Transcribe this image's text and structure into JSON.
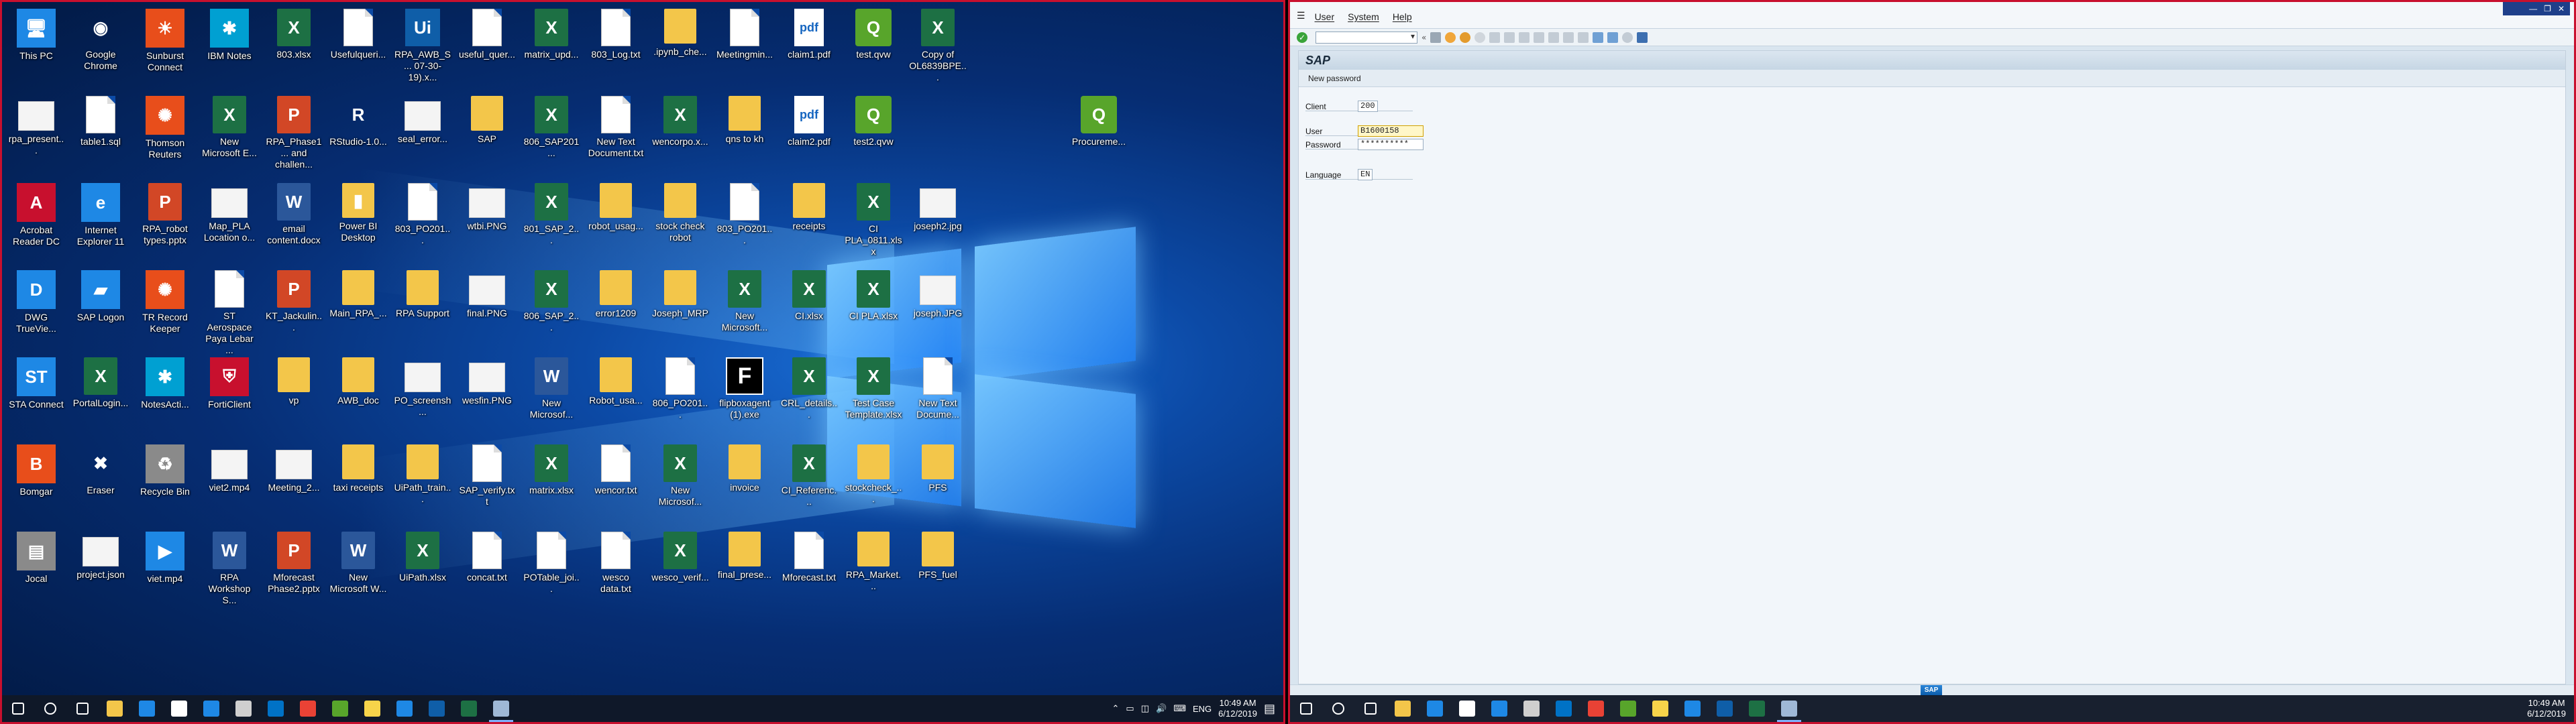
{
  "left_desktop": {
    "icons": [
      {
        "label": "This PC",
        "icon": "this-pc-icon",
        "kind": "blue",
        "glyph": "🖥"
      },
      {
        "label": "Google Chrome",
        "icon": "chrome-icon",
        "kind": "round",
        "glyph": "◉"
      },
      {
        "label": "Sunburst Connect",
        "icon": "sunburst-icon",
        "kind": "orange",
        "glyph": "☀"
      },
      {
        "label": "IBM Notes",
        "icon": "ibm-notes-icon",
        "kind": "teal",
        "glyph": "✱"
      },
      {
        "label": "803.xlsx",
        "icon": "excel-file-icon",
        "kind": "xls",
        "glyph": "X"
      },
      {
        "label": "Usefulqueri...",
        "icon": "document-icon",
        "kind": "doc",
        "glyph": ""
      },
      {
        "label": "RPA_AWB_S... 07-30-19).x...",
        "icon": "uipath-icon",
        "kind": "uipath",
        "glyph": "Ui"
      },
      {
        "label": "useful_quer...",
        "icon": "document-icon",
        "kind": "doc",
        "glyph": ""
      },
      {
        "label": "matrix_upd...",
        "icon": "excel-file-icon",
        "kind": "xls",
        "glyph": "X"
      },
      {
        "label": "803_Log.txt",
        "icon": "text-file-icon",
        "kind": "doc",
        "glyph": ""
      },
      {
        "label": ".ipynb_che...",
        "icon": "folder-icon",
        "kind": "folder",
        "glyph": ""
      },
      {
        "label": "Meetingmin...",
        "icon": "document-icon",
        "kind": "doc",
        "glyph": ""
      },
      {
        "label": "claim1.pdf",
        "icon": "pdf-icon",
        "kind": "pdf",
        "glyph": "pdf"
      },
      {
        "label": "test.qvw",
        "icon": "qlikview-icon",
        "kind": "qv",
        "glyph": "Q"
      },
      {
        "label": "Copy of OL6839BPE...",
        "icon": "excel-file-icon",
        "kind": "xls",
        "glyph": "X"
      },
      {
        "label": "rpa_present...",
        "icon": "image-file-icon",
        "kind": "img",
        "glyph": ""
      },
      {
        "label": "table1.sql",
        "icon": "sql-file-icon",
        "kind": "doc",
        "glyph": ""
      },
      {
        "label": "Thomson Reuters",
        "icon": "thomson-reuters-icon",
        "kind": "orange",
        "glyph": "✺"
      },
      {
        "label": "New Microsoft E...",
        "icon": "excel-file-icon",
        "kind": "xls",
        "glyph": "X"
      },
      {
        "label": "RPA_Phase1... and challen...",
        "icon": "powerpoint-icon",
        "kind": "ppt",
        "glyph": "P"
      },
      {
        "label": "RStudio-1.0...",
        "icon": "rstudio-icon",
        "kind": "round",
        "glyph": "R"
      },
      {
        "label": "seal_error...",
        "icon": "image-file-icon",
        "kind": "img",
        "glyph": ""
      },
      {
        "label": "SAP",
        "icon": "folder-icon",
        "kind": "folder",
        "glyph": ""
      },
      {
        "label": "806_SAP201...",
        "icon": "excel-file-icon",
        "kind": "xls",
        "glyph": "X"
      },
      {
        "label": "New Text Document.txt",
        "icon": "text-file-icon",
        "kind": "doc",
        "glyph": ""
      },
      {
        "label": "wencorpo.x...",
        "icon": "excel-file-icon",
        "kind": "xls",
        "glyph": "X"
      },
      {
        "label": "qns to kh",
        "icon": "folder-icon",
        "kind": "folder",
        "glyph": ""
      },
      {
        "label": "claim2.pdf",
        "icon": "pdf-icon",
        "kind": "pdf",
        "glyph": "pdf"
      },
      {
        "label": "test2.qvw",
        "icon": "qlikview-icon",
        "kind": "qv",
        "glyph": "Q"
      },
      {
        "label": "Procureme...",
        "icon": "qlikview-icon",
        "kind": "qv",
        "glyph": "Q"
      },
      {
        "label": "Acrobat Reader DC",
        "icon": "acrobat-icon",
        "kind": "red",
        "glyph": "A"
      },
      {
        "label": "Internet Explorer 11",
        "icon": "internet-explorer-icon",
        "kind": "blue",
        "glyph": "e"
      },
      {
        "label": "RPA_robot types.pptx",
        "icon": "powerpoint-icon",
        "kind": "ppt",
        "glyph": "P"
      },
      {
        "label": "Map_PLA Location o...",
        "icon": "image-file-icon",
        "kind": "img",
        "glyph": ""
      },
      {
        "label": "email content.docx",
        "icon": "word-icon",
        "kind": "word",
        "glyph": "W"
      },
      {
        "label": "Power BI Desktop",
        "icon": "power-bi-icon",
        "kind": "folder",
        "glyph": "▮"
      },
      {
        "label": "803_PO201...",
        "icon": "document-icon",
        "kind": "doc",
        "glyph": ""
      },
      {
        "label": "wtbi.PNG",
        "icon": "image-file-icon",
        "kind": "img",
        "glyph": ""
      },
      {
        "label": "801_SAP_2...",
        "icon": "excel-file-icon",
        "kind": "xls",
        "glyph": "X"
      },
      {
        "label": "robot_usag...",
        "icon": "folder-icon",
        "kind": "folder",
        "glyph": ""
      },
      {
        "label": "stock check robot",
        "icon": "folder-icon",
        "kind": "folder",
        "glyph": ""
      },
      {
        "label": "803_PO201...",
        "icon": "document-icon",
        "kind": "doc",
        "glyph": ""
      },
      {
        "label": "receipts",
        "icon": "folder-icon",
        "kind": "folder",
        "glyph": ""
      },
      {
        "label": "CI PLA_0811.xlsx",
        "icon": "excel-file-icon",
        "kind": "xls",
        "glyph": "X"
      },
      {
        "label": "joseph2.jpg",
        "icon": "image-file-icon",
        "kind": "img",
        "glyph": ""
      },
      {
        "label": "DWG TrueVie...",
        "icon": "dwg-icon",
        "kind": "blue",
        "glyph": "D"
      },
      {
        "label": "SAP Logon",
        "icon": "sap-logon-icon",
        "kind": "blue",
        "glyph": "▰"
      },
      {
        "label": "TR Record Keeper",
        "icon": "tr-record-icon",
        "kind": "orange",
        "glyph": "✺"
      },
      {
        "label": "ST Aerospace Paya Lebar ...",
        "icon": "document-icon",
        "kind": "doc",
        "glyph": ""
      },
      {
        "label": "KT_Jackulin...",
        "icon": "powerpoint-icon",
        "kind": "ppt",
        "glyph": "P"
      },
      {
        "label": "Main_RPA_...",
        "icon": "folder-icon",
        "kind": "folder",
        "glyph": ""
      },
      {
        "label": "RPA Support",
        "icon": "folder-icon",
        "kind": "folder",
        "glyph": ""
      },
      {
        "label": "final.PNG",
        "icon": "image-file-icon",
        "kind": "img",
        "glyph": ""
      },
      {
        "label": "806_SAP_2...",
        "icon": "excel-file-icon",
        "kind": "xls",
        "glyph": "X"
      },
      {
        "label": "error1209",
        "icon": "folder-icon",
        "kind": "folder",
        "glyph": ""
      },
      {
        "label": "Joseph_MRP",
        "icon": "folder-icon",
        "kind": "folder",
        "glyph": ""
      },
      {
        "label": "New Microsoft...",
        "icon": "excel-file-icon",
        "kind": "xls",
        "glyph": "X"
      },
      {
        "label": "CI.xlsx",
        "icon": "excel-file-icon",
        "kind": "xls",
        "glyph": "X"
      },
      {
        "label": "CI PLA.xlsx",
        "icon": "excel-file-icon",
        "kind": "xls",
        "glyph": "X"
      },
      {
        "label": "joseph.JPG",
        "icon": "image-file-icon",
        "kind": "img",
        "glyph": ""
      },
      {
        "label": "STA Connect",
        "icon": "sta-connect-icon",
        "kind": "blue",
        "glyph": "ST"
      },
      {
        "label": "PortalLogin...",
        "icon": "excel-file-icon",
        "kind": "xls",
        "glyph": "X"
      },
      {
        "label": "NotesActi...",
        "icon": "notes-icon",
        "kind": "teal",
        "glyph": "✱"
      },
      {
        "label": "FortiClient",
        "icon": "forticlient-icon",
        "kind": "red",
        "glyph": "⛨"
      },
      {
        "label": "vp",
        "icon": "folder-icon",
        "kind": "folder",
        "glyph": ""
      },
      {
        "label": "AWB_doc",
        "icon": "folder-icon",
        "kind": "folder",
        "glyph": ""
      },
      {
        "label": "PO_screensh...",
        "icon": "image-file-icon",
        "kind": "img",
        "glyph": ""
      },
      {
        "label": "wesfin.PNG",
        "icon": "image-file-icon",
        "kind": "img",
        "glyph": ""
      },
      {
        "label": "New Microsof...",
        "icon": "word-icon",
        "kind": "word",
        "glyph": "W"
      },
      {
        "label": "Robot_usa...",
        "icon": "folder-icon",
        "kind": "folder",
        "glyph": ""
      },
      {
        "label": "806_PO201...",
        "icon": "document-icon",
        "kind": "doc",
        "glyph": ""
      },
      {
        "label": "flipboxagent (1).exe",
        "icon": "flipbox-icon",
        "kind": "black",
        "glyph": "F"
      },
      {
        "label": "CRL_details...",
        "icon": "excel-file-icon",
        "kind": "xls",
        "glyph": "X"
      },
      {
        "label": "Test Case Template.xlsx",
        "icon": "excel-file-icon",
        "kind": "xls",
        "glyph": "X"
      },
      {
        "label": "New Text Docume...",
        "icon": "text-file-icon",
        "kind": "doc",
        "glyph": ""
      },
      {
        "label": "Bomgar",
        "icon": "bomgar-icon",
        "kind": "orange",
        "glyph": "B"
      },
      {
        "label": "Eraser",
        "icon": "eraser-icon",
        "kind": "round",
        "glyph": "✖"
      },
      {
        "label": "Recycle Bin",
        "icon": "recycle-bin-icon",
        "kind": "grey",
        "glyph": "♻"
      },
      {
        "label": "viet2.mp4",
        "icon": "video-file-icon",
        "kind": "img",
        "glyph": ""
      },
      {
        "label": "Meeting_2...",
        "icon": "image-file-icon",
        "kind": "img",
        "glyph": ""
      },
      {
        "label": "taxi receipts",
        "icon": "folder-icon",
        "kind": "folder",
        "glyph": ""
      },
      {
        "label": "UiPath_train...",
        "icon": "folder-icon",
        "kind": "folder",
        "glyph": ""
      },
      {
        "label": "SAP_verify.txt",
        "icon": "text-file-icon",
        "kind": "doc",
        "glyph": ""
      },
      {
        "label": "matrix.xlsx",
        "icon": "excel-file-icon",
        "kind": "xls",
        "glyph": "X"
      },
      {
        "label": "wencor.txt",
        "icon": "text-file-icon",
        "kind": "doc",
        "glyph": ""
      },
      {
        "label": "New Microsof...",
        "icon": "excel-file-icon",
        "kind": "xls",
        "glyph": "X"
      },
      {
        "label": "invoice",
        "icon": "folder-icon",
        "kind": "folder",
        "glyph": ""
      },
      {
        "label": "CI_Referenc...",
        "icon": "excel-file-icon",
        "kind": "xls",
        "glyph": "X"
      },
      {
        "label": "stockcheck_...",
        "icon": "folder-icon",
        "kind": "folder",
        "glyph": ""
      },
      {
        "label": "PFS",
        "icon": "folder-icon",
        "kind": "folder",
        "glyph": ""
      },
      {
        "label": "Jocal",
        "icon": "jocal-icon",
        "kind": "grey",
        "glyph": "▤"
      },
      {
        "label": "project.json",
        "icon": "json-file-icon",
        "kind": "img",
        "glyph": ""
      },
      {
        "label": "viet.mp4",
        "icon": "video-file-icon",
        "kind": "blue",
        "glyph": "▶"
      },
      {
        "label": "RPA Workshop S...",
        "icon": "word-icon",
        "kind": "word",
        "glyph": "W"
      },
      {
        "label": "Mforecast Phase2.pptx",
        "icon": "powerpoint-icon",
        "kind": "ppt",
        "glyph": "P"
      },
      {
        "label": "New Microsoft W...",
        "icon": "word-icon",
        "kind": "word",
        "glyph": "W"
      },
      {
        "label": "UiPath.xlsx",
        "icon": "excel-file-icon",
        "kind": "xls",
        "glyph": "X"
      },
      {
        "label": "concat.txt",
        "icon": "text-file-icon",
        "kind": "doc",
        "glyph": ""
      },
      {
        "label": "POTable_joi...",
        "icon": "text-file-icon",
        "kind": "doc",
        "glyph": ""
      },
      {
        "label": "wesco data.txt",
        "icon": "text-file-icon",
        "kind": "doc",
        "glyph": ""
      },
      {
        "label": "wesco_verif...",
        "icon": "excel-file-icon",
        "kind": "xls",
        "glyph": "X"
      },
      {
        "label": "final_prese...",
        "icon": "folder-icon",
        "kind": "folder",
        "glyph": ""
      },
      {
        "label": "Mforecast.txt",
        "icon": "text-file-icon",
        "kind": "doc",
        "glyph": ""
      },
      {
        "label": "RPA_Market...",
        "icon": "folder-icon",
        "kind": "folder",
        "glyph": ""
      },
      {
        "label": "PFS_fuel",
        "icon": "folder-icon",
        "kind": "folder",
        "glyph": ""
      }
    ]
  },
  "left_taskbar": {
    "apps": [
      {
        "icon": "windows-start-icon",
        "color": "#ffffff"
      },
      {
        "icon": "search-icon",
        "color": "#ffffff"
      },
      {
        "icon": "task-view-icon",
        "color": "#ffffff"
      },
      {
        "icon": "file-explorer-icon",
        "color": "#f3c64a"
      },
      {
        "icon": "edge-icon",
        "color": "#1e88e5"
      },
      {
        "icon": "store-icon",
        "color": "#ffffff"
      },
      {
        "icon": "internet-explorer-icon",
        "color": "#1e88e5"
      },
      {
        "icon": "tools-icon",
        "color": "#cfcfcf"
      },
      {
        "icon": "outlook-icon",
        "color": "#0072c6"
      },
      {
        "icon": "chrome-icon",
        "color": "#e94235"
      },
      {
        "icon": "qlikview-icon",
        "color": "#58a52b"
      },
      {
        "icon": "sticky-notes-icon",
        "color": "#f7d44a"
      },
      {
        "icon": "internet-explorer-icon",
        "color": "#1e88e5"
      },
      {
        "icon": "uipath-icon",
        "color": "#0f5ea8"
      },
      {
        "icon": "excel-icon",
        "color": "#1d7044"
      },
      {
        "icon": "sap-logon-icon",
        "color": "#9fb8d6"
      }
    ],
    "language": "ENG",
    "time": "10:49 AM",
    "date": "6/12/2019"
  },
  "sap": {
    "menu": [
      "User",
      "System",
      "Help"
    ],
    "title": "SAP",
    "app_toolbar_label": "New password",
    "fields": {
      "client_label": "Client",
      "client_value": "200",
      "user_label": "User",
      "user_value": "B1600158",
      "password_label": "Password",
      "password_value": "**********",
      "language_label": "Language",
      "language_value": "EN"
    },
    "status_logo": "SAP"
  },
  "right_taskbar": {
    "apps": [
      {
        "icon": "windows-start-icon",
        "color": "#ffffff"
      },
      {
        "icon": "search-icon",
        "color": "#ffffff"
      },
      {
        "icon": "task-view-icon",
        "color": "#ffffff"
      },
      {
        "icon": "file-explorer-icon",
        "color": "#f3c64a"
      },
      {
        "icon": "edge-icon",
        "color": "#1e88e5"
      },
      {
        "icon": "store-icon",
        "color": "#ffffff"
      },
      {
        "icon": "internet-explorer-icon",
        "color": "#1e88e5"
      },
      {
        "icon": "tools-icon",
        "color": "#cfcfcf"
      },
      {
        "icon": "outlook-icon",
        "color": "#0072c6"
      },
      {
        "icon": "chrome-icon",
        "color": "#e94235"
      },
      {
        "icon": "qlikview-icon",
        "color": "#58a52b"
      },
      {
        "icon": "sticky-notes-icon",
        "color": "#f7d44a"
      },
      {
        "icon": "internet-explorer-icon",
        "color": "#1e88e5"
      },
      {
        "icon": "uipath-icon",
        "color": "#0f5ea8"
      },
      {
        "icon": "excel-icon",
        "color": "#1d7044"
      },
      {
        "icon": "sap-logon-icon",
        "color": "#9fb8d6"
      }
    ],
    "time": "10:49 AM",
    "date": "6/12/2019"
  }
}
